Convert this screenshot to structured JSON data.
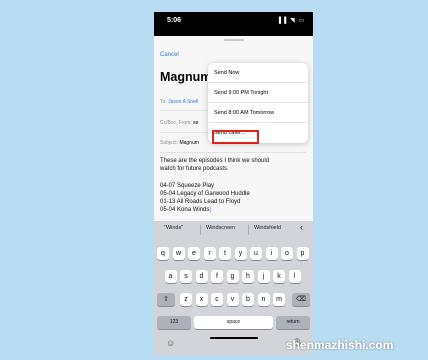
{
  "status_bar": {
    "time": "5:06",
    "icons": "▐▐ ◥ ▭"
  },
  "compose": {
    "cancel": "Cancel",
    "title": "Magnum episodes",
    "send_icon": "↑",
    "to_label": "To:",
    "to_value": "Jason A Snell",
    "cc_label": "Cc/Bcc, From:",
    "cc_value": "se",
    "subject_label": "Subject:",
    "subject_value": "Magnum",
    "body_intro_1": "These are the episodes I think we should",
    "body_intro_2": "watch for future podcasts.",
    "episodes": [
      "04-07 Squeeze Play",
      "05-04 Legacy of Garwood Huddle",
      "01-13 All Roads Lead to Floyd",
      "05-04 Kona Winds"
    ],
    "cursor": "|"
  },
  "send_menu": {
    "items": [
      "Send Now",
      "Send 9:00 PM Tonight",
      "Send 8:00 AM Tomorrow",
      "Send Later..."
    ]
  },
  "keyboard": {
    "suggestions": [
      "\"Winds\"",
      "Windscreen",
      "Windshield"
    ],
    "suggestion_chevron": "‹",
    "row1": [
      "q",
      "w",
      "e",
      "r",
      "t",
      "y",
      "u",
      "i",
      "o",
      "p"
    ],
    "row2": [
      "a",
      "s",
      "d",
      "f",
      "g",
      "h",
      "j",
      "k",
      "l"
    ],
    "row3": [
      "z",
      "x",
      "c",
      "v",
      "b",
      "n",
      "m"
    ],
    "shift": "⇧",
    "backspace": "⌫",
    "numbers": "123",
    "space": "space",
    "return": "return",
    "emoji": "☺",
    "mic": "🎙"
  },
  "watermark": "shenmazhishi.com"
}
